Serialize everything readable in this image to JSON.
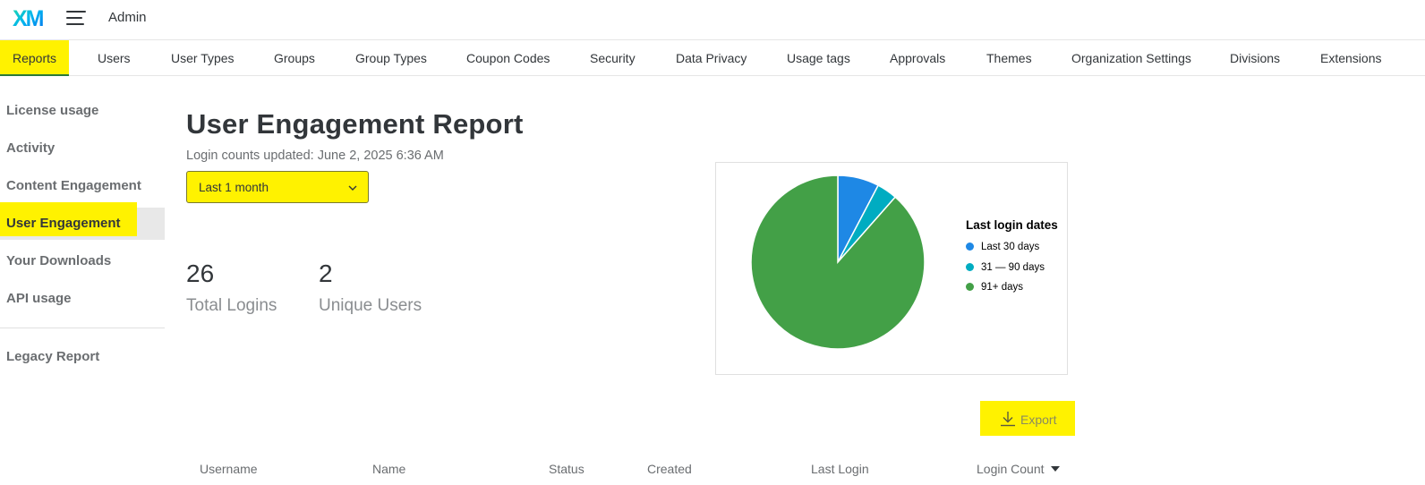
{
  "header": {
    "logo_text": "XM",
    "app_title": "Admin",
    "menu_icon": "hamburger-menu-icon"
  },
  "tabs": [
    {
      "label": "Reports",
      "active": true
    },
    {
      "label": "Users"
    },
    {
      "label": "User Types"
    },
    {
      "label": "Groups"
    },
    {
      "label": "Group Types"
    },
    {
      "label": "Coupon Codes"
    },
    {
      "label": "Security"
    },
    {
      "label": "Data Privacy"
    },
    {
      "label": "Usage tags"
    },
    {
      "label": "Approvals"
    },
    {
      "label": "Themes"
    },
    {
      "label": "Organization Settings"
    },
    {
      "label": "Divisions"
    },
    {
      "label": "Extensions"
    }
  ],
  "sidebar": {
    "items": [
      {
        "label": "License usage"
      },
      {
        "label": "Activity"
      },
      {
        "label": "Content Engagement"
      },
      {
        "label": "User Engagement",
        "active": true
      },
      {
        "label": "Your Downloads"
      },
      {
        "label": "API usage"
      },
      {
        "label": "Legacy Report"
      }
    ]
  },
  "main": {
    "title": "User Engagement Report",
    "updated_text": "Login counts updated: June 2, 2025 6:36 AM",
    "period_select": {
      "value": "Last 1 month"
    },
    "stats": [
      {
        "value": "26",
        "label": "Total Logins"
      },
      {
        "value": "2",
        "label": "Unique Users"
      }
    ],
    "export_label": "Export"
  },
  "chart_data": {
    "type": "pie",
    "legend_title": "Last login dates",
    "legend_position": "right",
    "slices": [
      {
        "label": "Last 30 days",
        "value": 7.7,
        "color": "#1e88e5"
      },
      {
        "label": "31 — 90 days",
        "value": 3.8,
        "color": "#00acc1"
      },
      {
        "label": "91+ days",
        "value": 88.5,
        "color": "#43a047"
      }
    ]
  },
  "table": {
    "columns": [
      "Username",
      "Name",
      "Status",
      "Created",
      "Last Login",
      "Login Count"
    ],
    "sorted_column": "Login Count",
    "sort_direction": "descending"
  },
  "colors": {
    "highlight": "#fff200",
    "text": "#32363a",
    "muted": "#6a6d70"
  }
}
